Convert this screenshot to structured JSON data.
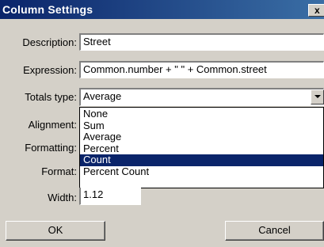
{
  "window": {
    "title": "Column Settings",
    "close_glyph": "x",
    "close_icon": "close-icon"
  },
  "fields": {
    "description": {
      "label": "Description:",
      "value": "Street"
    },
    "expression": {
      "label": "Expression:",
      "value": "Common.number + \" \" + Common.street"
    },
    "totals_type": {
      "label": "Totals type:",
      "value": "Average"
    },
    "alignment": {
      "label": "Alignment:"
    },
    "formatting": {
      "label": "Formatting:"
    },
    "format": {
      "label": "Format:"
    },
    "width": {
      "label": "Width:",
      "value": "1.12"
    }
  },
  "dropdown": {
    "options": [
      "None",
      "Sum",
      "Average",
      "Percent",
      "Count",
      "Percent Count"
    ],
    "highlighted": "Count"
  },
  "buttons": {
    "ok": "OK",
    "cancel": "Cancel"
  },
  "colors": {
    "titlebar": "#0a246a",
    "selection": "#0a246a",
    "face": "#d4d0c8"
  }
}
